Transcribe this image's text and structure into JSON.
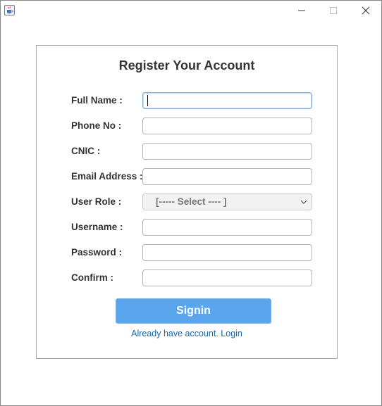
{
  "window": {
    "icon": "java-cup-icon",
    "controls": [
      "minimize-icon",
      "maximize-icon",
      "close-icon"
    ]
  },
  "form": {
    "title": "Register Your Account",
    "fields": {
      "full_name": {
        "label": "Full Name :",
        "value": ""
      },
      "phone": {
        "label": "Phone No :",
        "value": ""
      },
      "cnic": {
        "label": "CNIC :",
        "value": ""
      },
      "email": {
        "label": "Email Address :",
        "value": ""
      },
      "user_role": {
        "label": "User Role :",
        "selected": "[----- Select ---- ]"
      },
      "username": {
        "label": "Username :",
        "value": ""
      },
      "password": {
        "label": "Password :",
        "value": ""
      },
      "confirm": {
        "label": "Confirm :",
        "value": ""
      }
    },
    "submit_label": "Signin",
    "login_link": "Already have account. Login"
  },
  "colors": {
    "button_bg": "#5aa6ee",
    "link": "#1565b0",
    "focus_border": "#7fb0de"
  }
}
